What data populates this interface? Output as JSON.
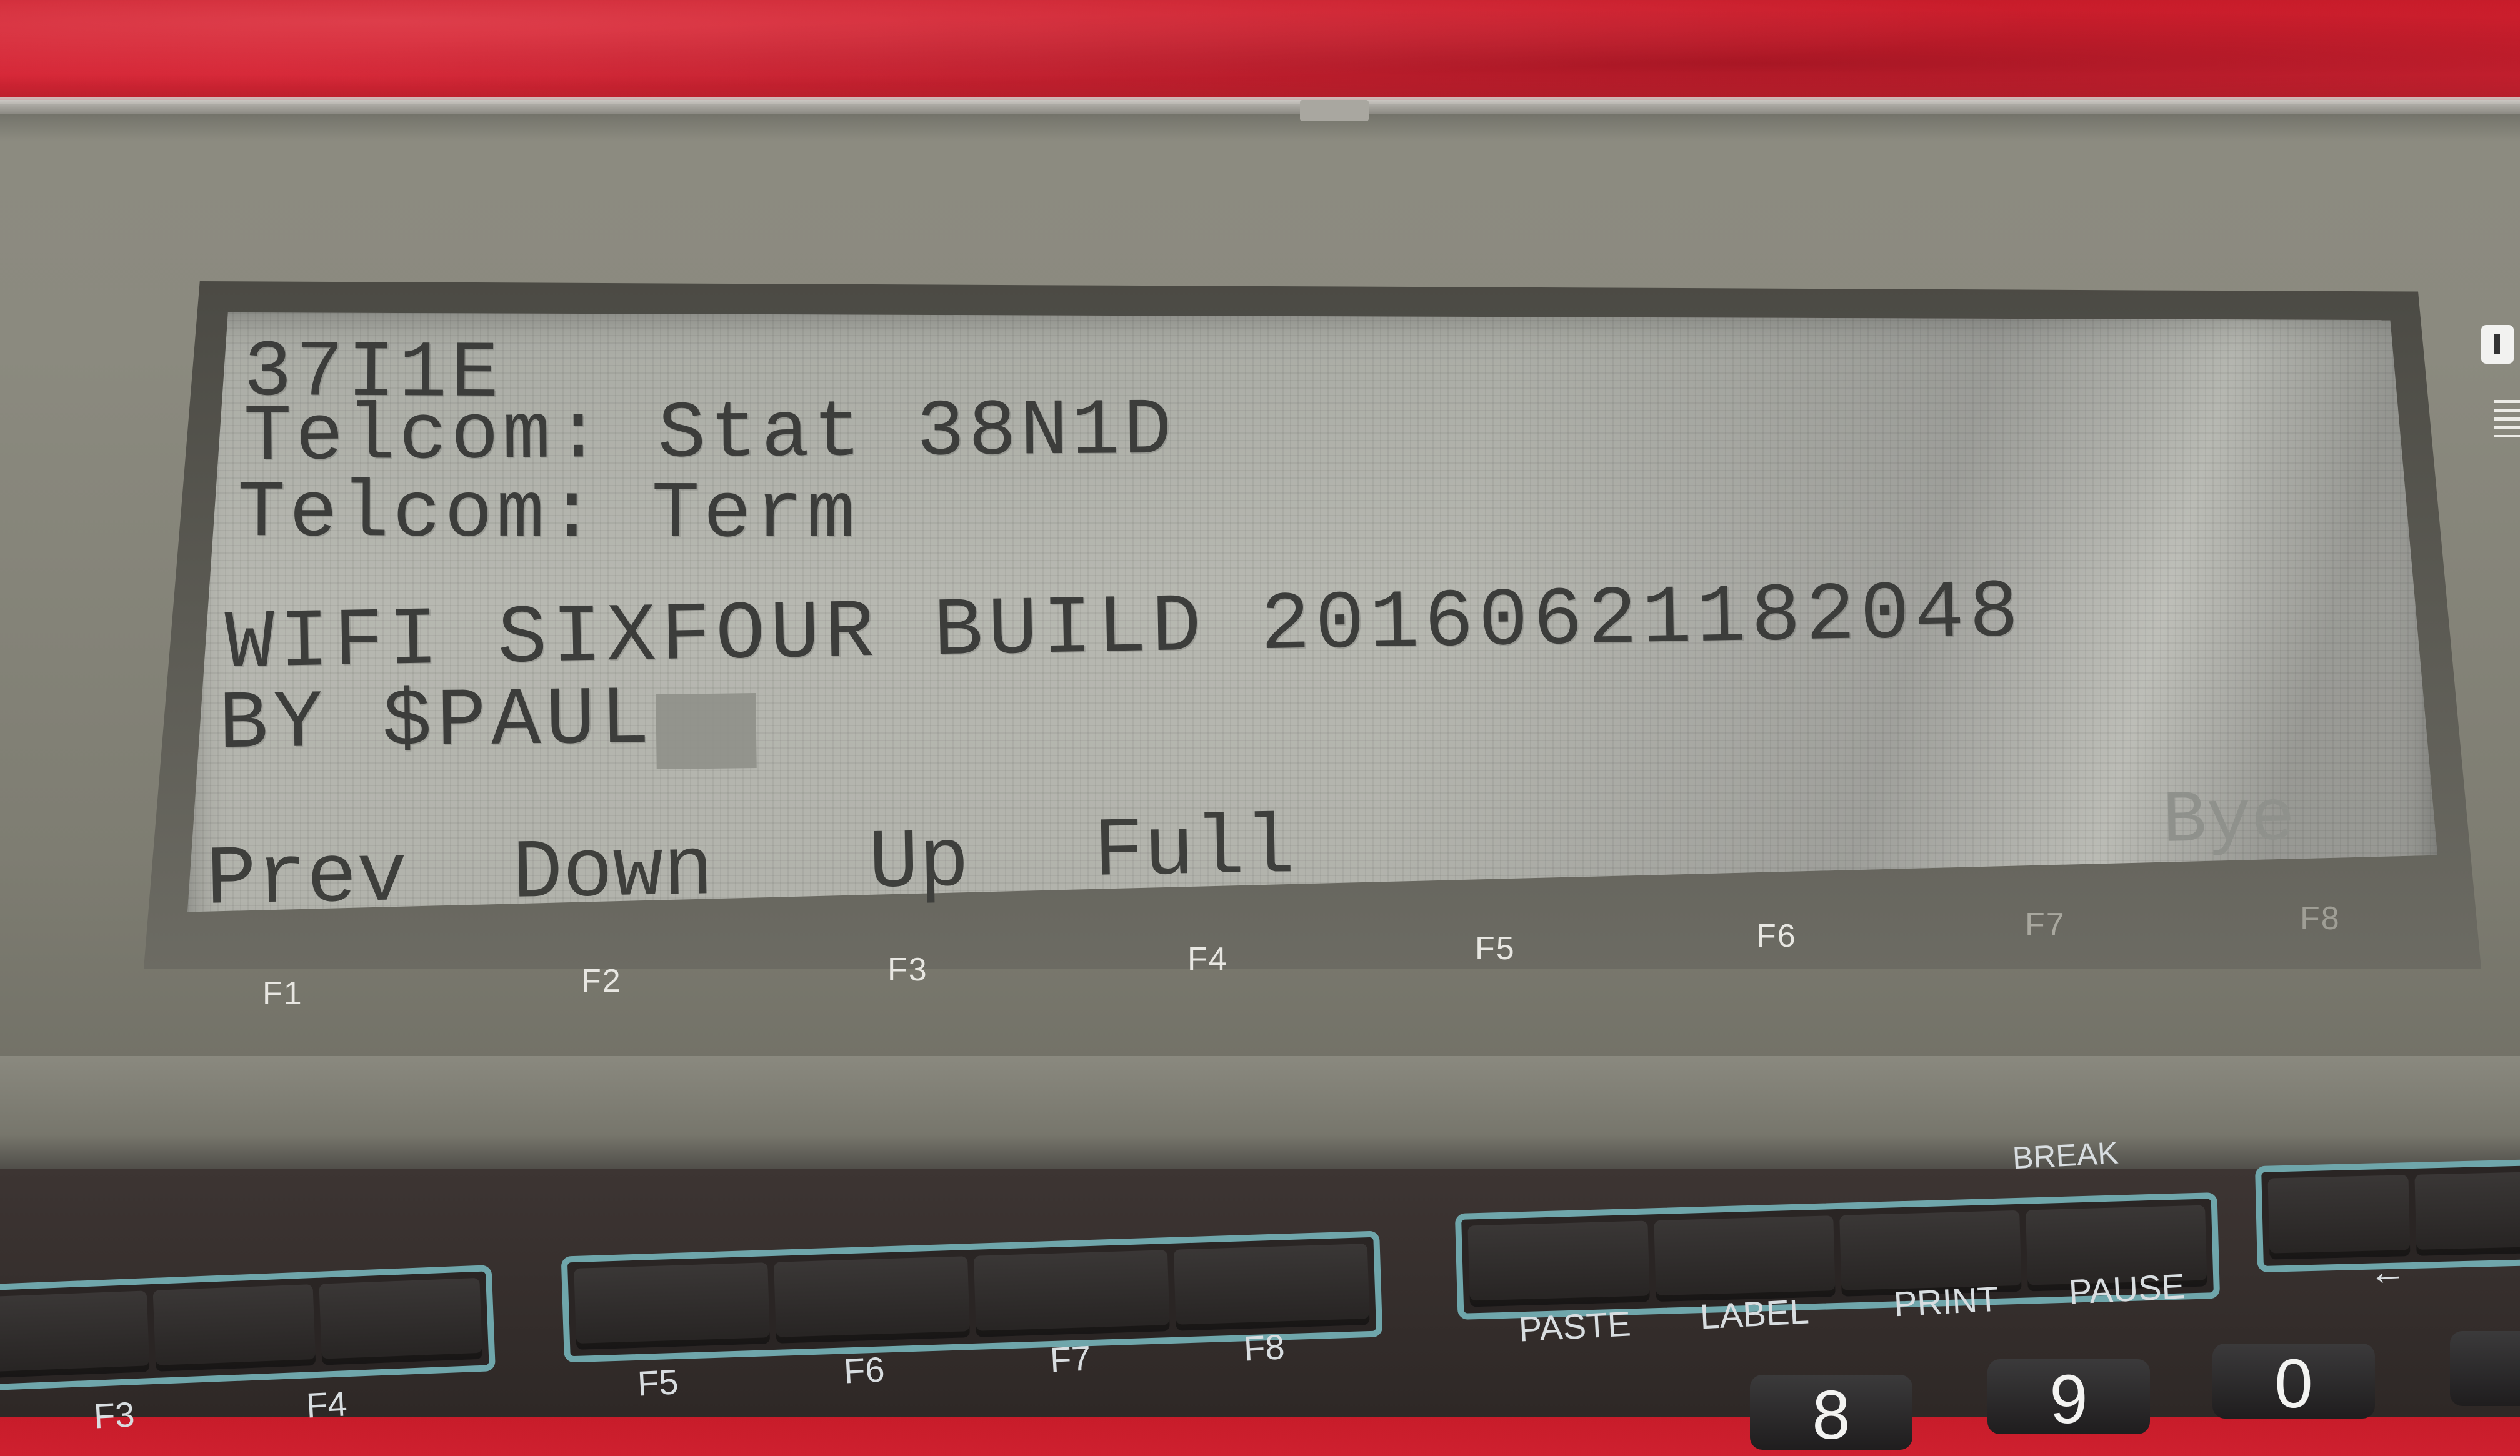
{
  "screen": {
    "lines": [
      "37I1E",
      "Telcom: Stat 38N1D",
      "Telcom: Term",
      "WIFI SIXFOUR BUILD 20160621182048",
      "BY $PAUL"
    ],
    "softkeys": {
      "prev": "Prev",
      "down": "Down",
      "up": "Up",
      "full": "Full",
      "bye": "Bye"
    }
  },
  "bezel_labels": [
    "F1",
    "F2",
    "F3",
    "F4",
    "F5",
    "F6",
    "F7",
    "F8"
  ],
  "keyboard_labels": {
    "f3": "F3",
    "f4": "F4",
    "f5": "F5",
    "f6": "F6",
    "f7": "F7",
    "f8": "F8",
    "paste": "PASTE",
    "label": "LABEL",
    "print": "PRINT",
    "pause": "PAUSE",
    "break": "BREAK",
    "arrow": "←"
  },
  "number_keys": [
    "8",
    "9",
    "0"
  ],
  "colors": {
    "lcd_background": "#b1b2ab",
    "lcd_text": "#3c3d3b",
    "key_group_outline": "#6fa6ab",
    "cloth": "#c81c2a"
  }
}
